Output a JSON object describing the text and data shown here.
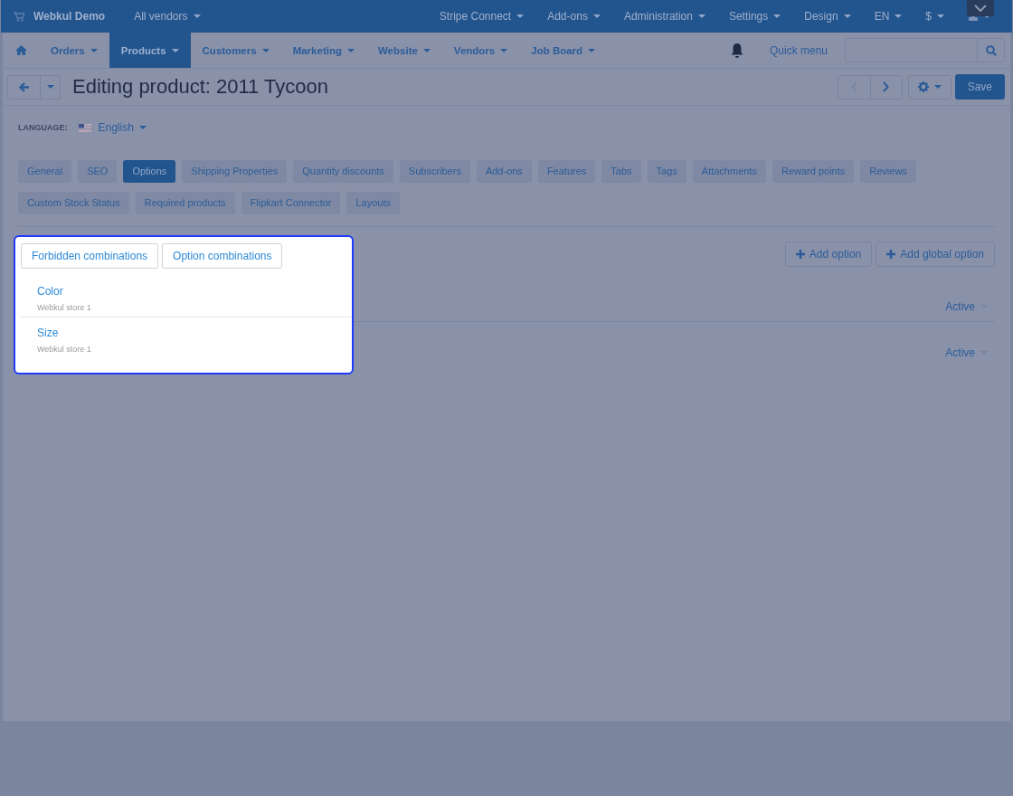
{
  "top_bar": {
    "brand": "Webkul Demo",
    "vendor_menu": "All vendors",
    "menus": [
      "Stripe Connect",
      "Add-ons",
      "Administration",
      "Settings",
      "Design",
      "EN",
      "$"
    ]
  },
  "nav": {
    "items": [
      {
        "label": "Orders",
        "selected": false
      },
      {
        "label": "Products",
        "selected": true
      },
      {
        "label": "Customers",
        "selected": false
      },
      {
        "label": "Marketing",
        "selected": false
      },
      {
        "label": "Website",
        "selected": false
      },
      {
        "label": "Vendors",
        "selected": false
      },
      {
        "label": "Job Board",
        "selected": false
      }
    ],
    "quick_menu": "Quick menu"
  },
  "title": "Editing product: 2011 Tycoon",
  "save_button": "Save",
  "language": {
    "label": "LANGUAGE:",
    "value": "English"
  },
  "tabs": [
    {
      "label": "General",
      "selected": false
    },
    {
      "label": "SEO",
      "selected": false
    },
    {
      "label": "Options",
      "selected": true
    },
    {
      "label": "Shipping Properties",
      "selected": false
    },
    {
      "label": "Quantity discounts",
      "selected": false
    },
    {
      "label": "Subscribers",
      "selected": false
    },
    {
      "label": "Add-ons",
      "selected": false
    },
    {
      "label": "Features",
      "selected": false
    },
    {
      "label": "Tabs",
      "selected": false
    },
    {
      "label": "Tags",
      "selected": false
    },
    {
      "label": "Attachments",
      "selected": false
    },
    {
      "label": "Reward points",
      "selected": false
    },
    {
      "label": "Reviews",
      "selected": false
    },
    {
      "label": "Custom Stock Status",
      "selected": false
    },
    {
      "label": "Required products",
      "selected": false
    },
    {
      "label": "Flipkart Connector",
      "selected": false
    },
    {
      "label": "Layouts",
      "selected": false
    }
  ],
  "combination_buttons": [
    "Forbidden combinations",
    "Option combinations"
  ],
  "add_buttons": [
    "Add option",
    "Add global option"
  ],
  "options": [
    {
      "name": "Color",
      "store": "Webkul store 1",
      "status": "Active"
    },
    {
      "name": "Size",
      "store": "Webkul store 1",
      "status": "Active"
    }
  ]
}
